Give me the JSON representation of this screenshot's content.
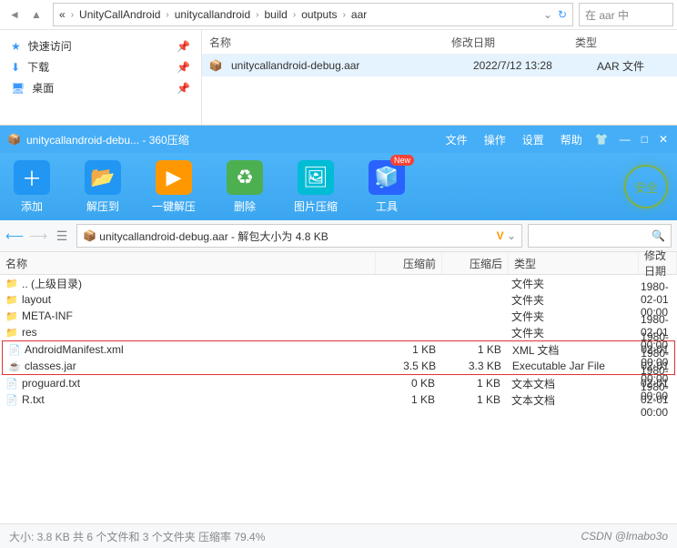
{
  "explorer": {
    "breadcrumb": [
      "UnityCallAndroid",
      "unitycallandroid",
      "build",
      "outputs",
      "aar"
    ],
    "search_placeholder": "在 aar 中",
    "sidebar": [
      {
        "label": "快速访问",
        "icon": "★"
      },
      {
        "label": "下载",
        "icon": "↓"
      },
      {
        "label": "桌面",
        "icon": "🖥"
      }
    ],
    "columns": {
      "name": "名称",
      "date": "修改日期",
      "type": "类型"
    },
    "file": {
      "name": "unitycallandroid-debug.aar",
      "date": "2022/7/12 13:28",
      "type": "AAR 文件"
    }
  },
  "archive": {
    "title": "unitycallandroid-debu... - 360压缩",
    "menu": [
      "文件",
      "操作",
      "设置",
      "帮助"
    ],
    "tools": [
      {
        "label": "添加",
        "key": "add"
      },
      {
        "label": "解压到",
        "key": "extract"
      },
      {
        "label": "一键解压",
        "key": "oneclick"
      },
      {
        "label": "删除",
        "key": "delete"
      },
      {
        "label": "图片压缩",
        "key": "image"
      },
      {
        "label": "工具",
        "key": "tools",
        "badge": "New"
      }
    ],
    "safe": "安全",
    "path": "unitycallandroid-debug.aar - 解包大小为 4.8 KB",
    "vlabel": "V",
    "columns": {
      "name": "名称",
      "pre": "压缩前",
      "post": "压缩后",
      "type": "类型",
      "date": "修改日期"
    },
    "rows": [
      {
        "name": ".. (上级目录)",
        "pre": "",
        "post": "",
        "type": "文件夹",
        "date": "",
        "icon": "folder"
      },
      {
        "name": "layout",
        "pre": "",
        "post": "",
        "type": "文件夹",
        "date": "1980-02-01 00:00",
        "icon": "folder"
      },
      {
        "name": "META-INF",
        "pre": "",
        "post": "",
        "type": "文件夹",
        "date": "",
        "icon": "folder"
      },
      {
        "name": "res",
        "pre": "",
        "post": "",
        "type": "文件夹",
        "date": "1980-02-01 00:00",
        "icon": "folder"
      },
      {
        "name": "AndroidManifest.xml",
        "pre": "1 KB",
        "post": "1 KB",
        "type": "XML 文档",
        "date": "1980-02-01 00:00",
        "icon": "file",
        "highlight": true
      },
      {
        "name": "classes.jar",
        "pre": "3.5 KB",
        "post": "3.3 KB",
        "type": "Executable Jar File",
        "date": "1980-02-01 00:00",
        "icon": "jar",
        "highlight": true
      },
      {
        "name": "proguard.txt",
        "pre": "0 KB",
        "post": "1 KB",
        "type": "文本文档",
        "date": "1980-02-01 00:00",
        "icon": "file"
      },
      {
        "name": "R.txt",
        "pre": "1 KB",
        "post": "1 KB",
        "type": "文本文档",
        "date": "1980-02-01 00:00",
        "icon": "file"
      }
    ],
    "status": "大小: 3.8 KB 共 6 个文件和 3 个文件夹 压缩率 79.4%",
    "watermark": "CSDN @lmabo3o"
  }
}
